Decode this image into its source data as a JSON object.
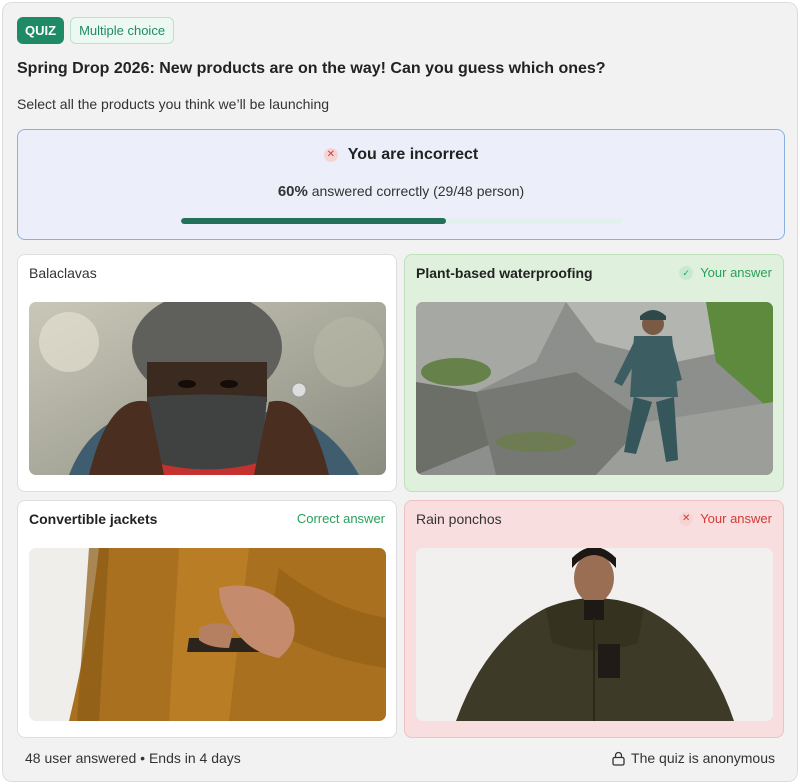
{
  "tags": {
    "quiz": "QUIZ",
    "type": "Multiple choice"
  },
  "question": {
    "title": "Spring Drop 2026: New products are on the way! Can you guess which ones?",
    "instruction": "Select all the products you think we’ll be launching"
  },
  "result": {
    "title": "You are incorrect",
    "percent": "60%",
    "stats_text": "answered correctly (29/48 person)",
    "correct_fraction": 0.6,
    "colors": {
      "bar_fill": "#23705a",
      "bar_track": "#e2f1ed",
      "panel_border": "#8ab0e0"
    }
  },
  "options": [
    {
      "label": "Balaclavas",
      "status": "",
      "image_icon": "balaclava-photo"
    },
    {
      "label": "Plant-based waterproofing",
      "status": "Your answer",
      "image_icon": "hiker-photo"
    },
    {
      "label": "Convertible jackets",
      "status": "Correct answer",
      "image_icon": "jacket-photo"
    },
    {
      "label": "Rain ponchos",
      "status": "Your answer",
      "image_icon": "poncho-photo"
    }
  ],
  "footer": {
    "meta": "48 user answered • Ends in 4 days",
    "anonymous": "The quiz is anonymous"
  },
  "colors": {
    "accent": "#1f8a66",
    "correct": "#2aa05a",
    "wrong": "#d33a3a"
  }
}
